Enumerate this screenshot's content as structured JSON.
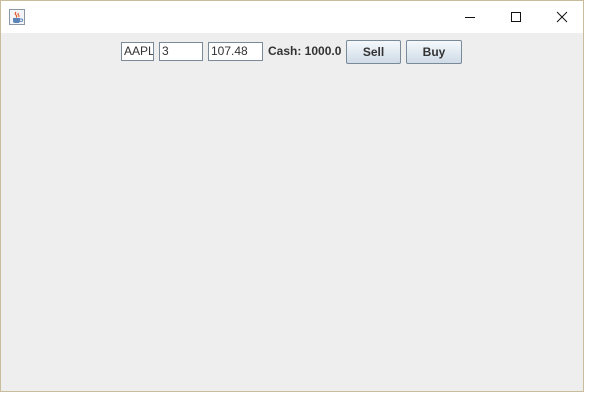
{
  "window": {
    "icon": "java-cup-icon",
    "controls": {
      "minimize_icon": "minimize-icon",
      "maximize_icon": "maximize-icon",
      "close_icon": "close-icon"
    }
  },
  "trade_form": {
    "symbol_value": "AAPL",
    "quantity_value": "3",
    "price_value": "107.48",
    "cash_label": "Cash: 1000.0",
    "sell_label": "Sell",
    "buy_label": "Buy"
  },
  "colors": {
    "content_background": "#eeeeee",
    "titlebar_background": "#ffffff",
    "window_border": "#c9bc9c"
  }
}
